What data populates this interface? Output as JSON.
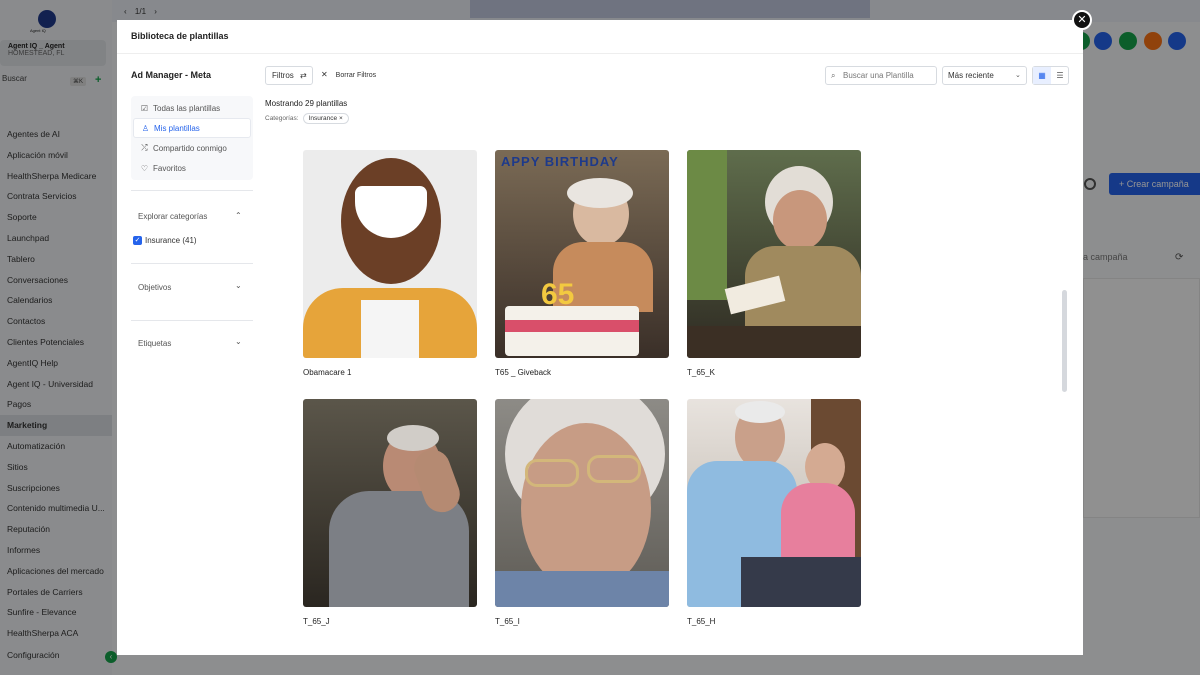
{
  "background": {
    "sidebar": {
      "logo_text": "Agent IQ",
      "account_name": "Agent IQ _ Agent",
      "account_sub": "HOMESTEAD, FL",
      "search_label": "Buscar",
      "search_shortcut": "⌘K",
      "items": [
        "Agentes de AI",
        "Aplicación móvil",
        "HealthSherpa Medicare",
        "Contrata Servicios",
        "Soporte",
        "Launchpad",
        "Tablero",
        "Conversaciones",
        "Calendarios",
        "Contactos",
        "Clientes Potenciales",
        "AgentIQ Help",
        "Agent IQ - Universidad",
        "Pagos",
        "Marketing",
        "Automatización",
        "Sitios",
        "Suscripciones",
        "Contenido multimedia U...",
        "Reputación",
        "Informes",
        "Aplicaciones del mercado",
        "Portales de Carriers",
        "Sunfire - Elevance",
        "HealthSherpa ACA"
      ],
      "active_item": "Marketing",
      "config_label": "Configuración"
    },
    "pagination": "1/1",
    "create_button": "+ Crear campaña",
    "campaign_text": "a campaña"
  },
  "modal": {
    "title": "Biblioteca de plantillas",
    "section_title": "Ad Manager - Meta",
    "nav": [
      {
        "icon": "☑",
        "label": "Todas las plantillas"
      },
      {
        "icon": "♙",
        "label": "Mis plantillas"
      },
      {
        "icon": "⤮",
        "label": "Compartido conmigo"
      },
      {
        "icon": "♡",
        "label": "Favoritos"
      }
    ],
    "explore_title": "Explorar categorías",
    "category_option": "Insurance (41)",
    "objectives_title": "Objetivos",
    "tags_title": "Etiquetas",
    "filters_label": "Filtros",
    "clear_filters_label": "Borrar Filtros",
    "search_placeholder": "Buscar una Plantilla",
    "sort_value": "Más reciente",
    "showing_text": "Mostrando 29 plantillas",
    "categories_label": "Categorías:",
    "category_chip": "Insurance ×",
    "templates": [
      {
        "name": "Obamacare 1"
      },
      {
        "name": "T65 _ Giveback"
      },
      {
        "name": "T_65_K"
      },
      {
        "name": "T_65_J"
      },
      {
        "name": "T_65_I"
      },
      {
        "name": "T_65_H"
      }
    ]
  }
}
